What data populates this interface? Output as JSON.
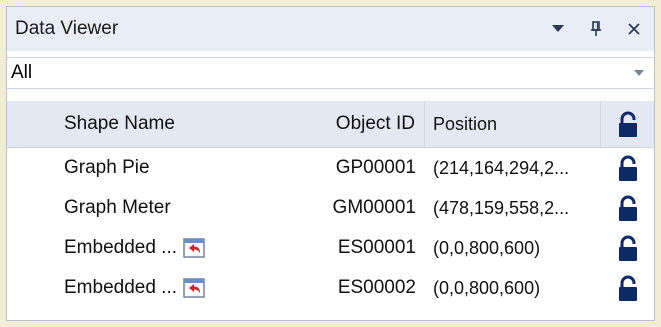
{
  "window": {
    "title": "Data Viewer"
  },
  "title_buttons": [
    {
      "name": "menu-dropdown-icon"
    },
    {
      "name": "pin-icon"
    },
    {
      "name": "close-icon"
    }
  ],
  "filter": {
    "value": "All"
  },
  "columns": {
    "shape_name": "Shape Name",
    "object_id": "Object ID",
    "position": "Position"
  },
  "rows": [
    {
      "shape_name": "Graph Pie",
      "object_id": "GP00001",
      "position": "(214,164,294,2...",
      "embedded": false
    },
    {
      "shape_name": "Graph Meter",
      "object_id": "GM00001",
      "position": "(478,159,558,2...",
      "embedded": false
    },
    {
      "shape_name": "Embedded ...",
      "object_id": "ES00001",
      "position": "(0,0,800,600)",
      "embedded": true
    },
    {
      "shape_name": "Embedded ...",
      "object_id": "ES00002",
      "position": "(0,0,800,600)",
      "embedded": true
    }
  ],
  "colors": {
    "lock": "#0d2a66",
    "header_bg": "#e3e8f2",
    "title_bg": "#e8edf6",
    "embed_icon": "#d4232b"
  }
}
